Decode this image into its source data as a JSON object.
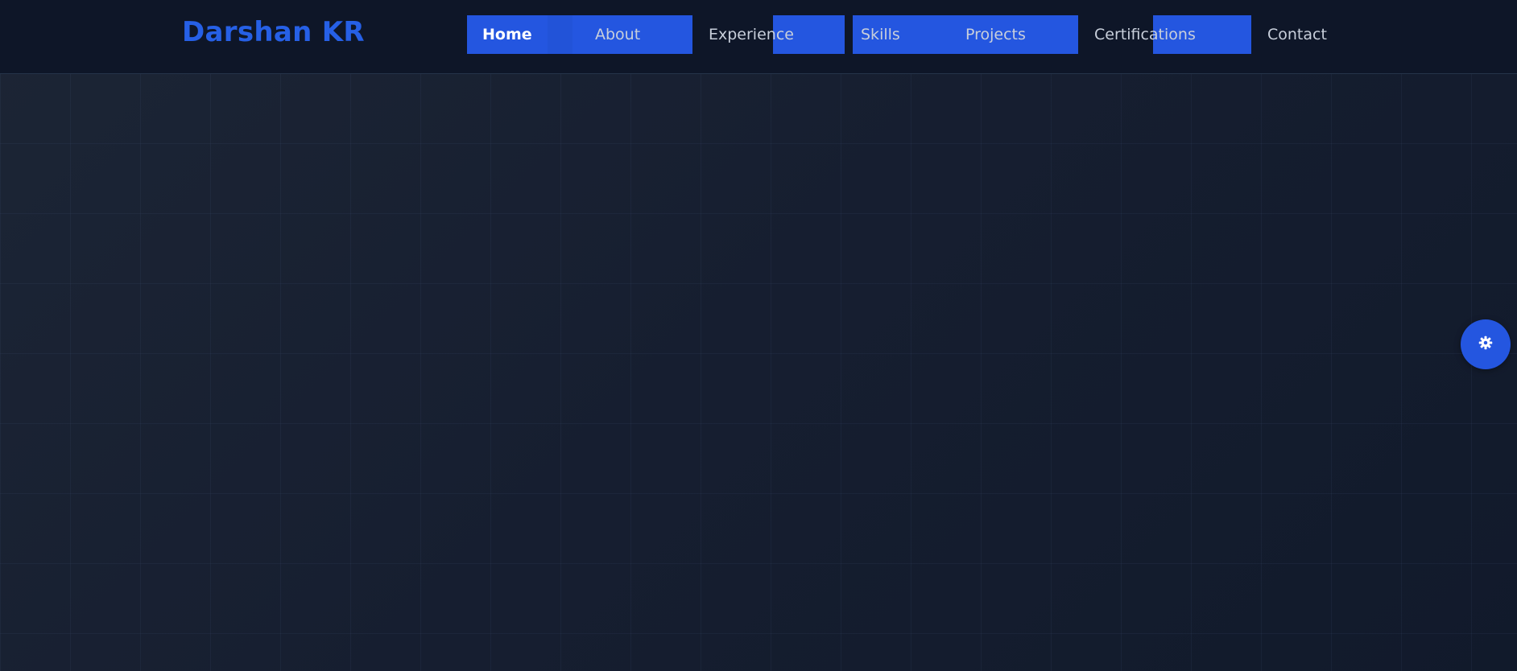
{
  "brand": {
    "name": "Darshan KR"
  },
  "nav": {
    "items": [
      {
        "label": "Home",
        "active": true
      },
      {
        "label": "About",
        "active": false
      },
      {
        "label": "Experience",
        "active": false
      },
      {
        "label": "Skills",
        "active": false
      },
      {
        "label": "Projects",
        "active": false
      },
      {
        "label": "Certifications",
        "active": false
      },
      {
        "label": "Contact",
        "active": false
      }
    ]
  },
  "fab": {
    "icon": "gear-icon"
  },
  "colors": {
    "accent": "#2456e0",
    "brand": "#2660e6",
    "navbar_bg": "#0e1628",
    "page_bg": "#161e30",
    "nav_text": "#c8cfdb"
  }
}
